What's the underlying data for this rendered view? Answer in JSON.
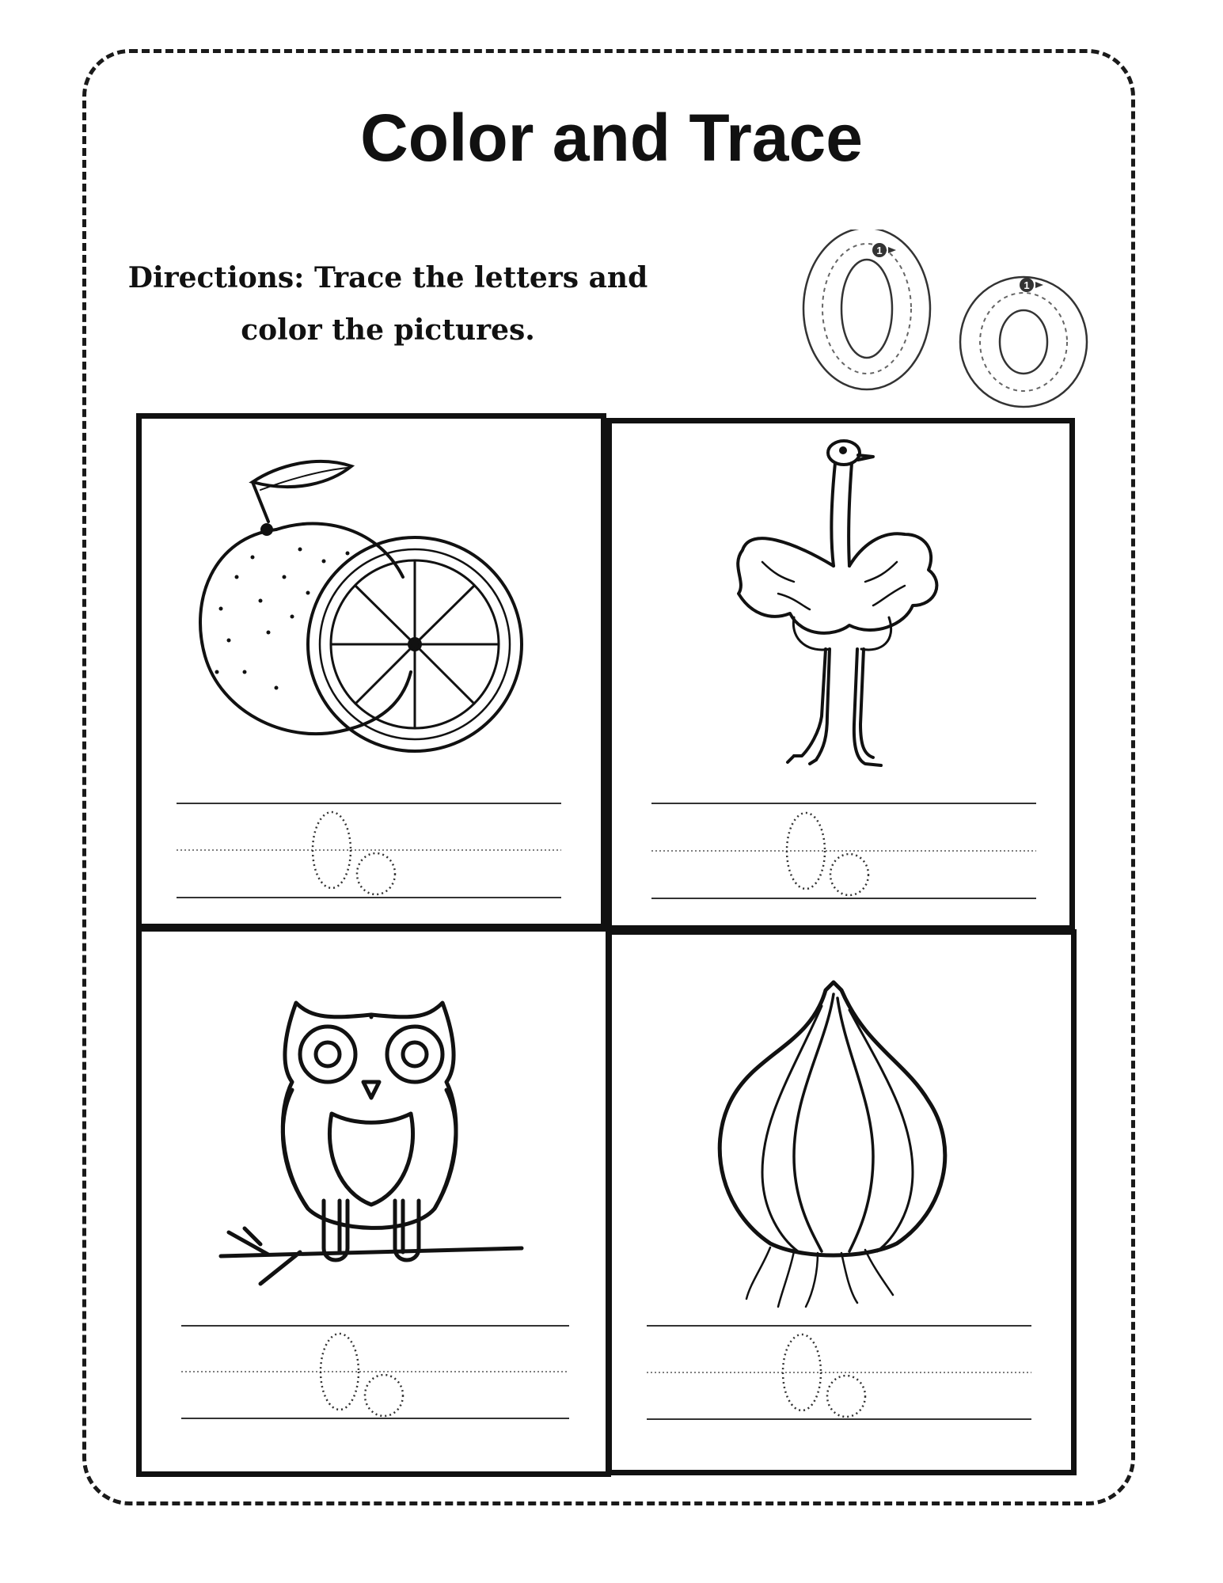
{
  "title": "Color and Trace",
  "directions": {
    "line1": "Directions: Trace the letters and",
    "line2": "color the pictures."
  },
  "letter_guide": {
    "uppercase": "O",
    "lowercase": "o",
    "stroke_number": "1"
  },
  "cards": [
    {
      "picture": "orange-icon",
      "trace": "Oo"
    },
    {
      "picture": "ostrich-icon",
      "trace": "Oo"
    },
    {
      "picture": "owl-icon",
      "trace": "Oo"
    },
    {
      "picture": "onion-icon",
      "trace": "Oo"
    }
  ]
}
